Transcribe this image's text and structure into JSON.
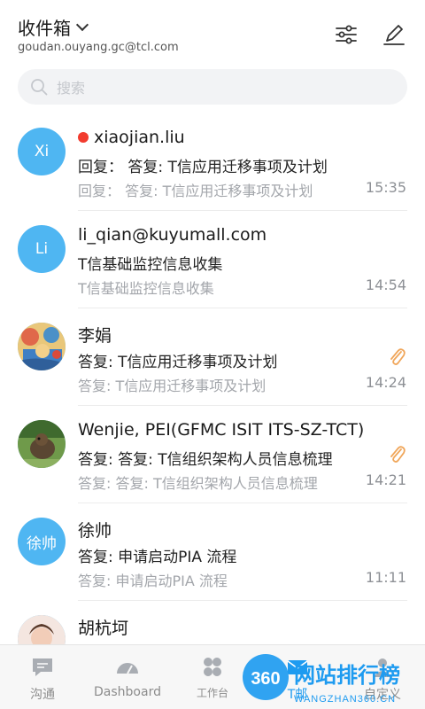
{
  "header": {
    "title": "收件箱",
    "account": "goudan.ouyang.gc@tcl.com",
    "filter_icon": "filter-sliders-icon",
    "compose_icon": "compose-pencil-icon"
  },
  "search": {
    "placeholder": "搜索"
  },
  "emails": [
    {
      "avatar_text": "Xi",
      "sender": "xiaojian.liu",
      "unread": true,
      "subject": "回复：  答复: T信应用迁移事项及计划",
      "preview": "回复：  答复: T信应用迁移事项及计划",
      "time": "15:35",
      "attachment": false
    },
    {
      "avatar_text": "Li",
      "sender": "li_qian@kuyumall.com",
      "unread": false,
      "subject": "T信基础监控信息收集",
      "preview": "T信基础监控信息收集",
      "time": "14:54",
      "attachment": false
    },
    {
      "avatar_text": "",
      "sender": "李娟",
      "unread": false,
      "subject": "答复: T信应用迁移事项及计划",
      "preview": "答复: T信应用迁移事项及计划",
      "time": "14:24",
      "attachment": true
    },
    {
      "avatar_text": "",
      "sender": "Wenjie, PEI(GFMC ISIT ITS-SZ-TCT)",
      "unread": false,
      "subject": "答复: 答复:  T信组织架构人员信息梳理",
      "preview": "答复: 答复:  T信组织架构人员信息梳理",
      "time": "14:21",
      "attachment": true
    },
    {
      "avatar_text": "徐帅",
      "sender": "徐帅",
      "unread": false,
      "subject": "答复: 申请启动PIA 流程",
      "preview": "答复: 申请启动PIA 流程",
      "time": "11:11",
      "attachment": false
    },
    {
      "avatar_text": "",
      "sender": "胡杭坷",
      "unread": false,
      "subject": "",
      "preview": "",
      "time": "",
      "attachment": false
    }
  ],
  "tabs": [
    {
      "label": "沟通",
      "icon": "chat-bubble-icon"
    },
    {
      "label": "Dashboard",
      "icon": "dashboard-gauge-icon"
    },
    {
      "label": "工作台",
      "icon": "workbench-grid-icon"
    },
    {
      "label": "T邮",
      "icon": "mail-icon"
    },
    {
      "label": "自定义",
      "icon": "person-icon"
    }
  ],
  "watermark": {
    "badge": "360",
    "title": "网站排行榜",
    "subtitle": "WANGZHAN360.CN"
  },
  "colors": {
    "accent_blue": "#4fb6f2",
    "unread_red": "#f23b2e",
    "attachment_orange": "#f0a65a",
    "watermark_blue": "#1e9bf0"
  }
}
